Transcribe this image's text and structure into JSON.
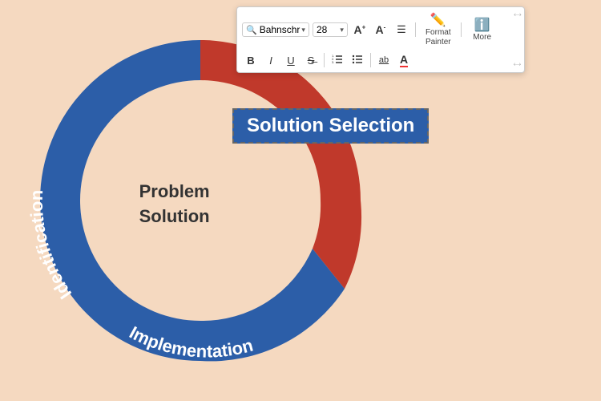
{
  "toolbar": {
    "font_name": "Bahnschr",
    "font_size": "28",
    "format_painter_label": "Format\nPainter",
    "more_label": "More",
    "buttons": {
      "bold": "B",
      "italic": "I",
      "underline": "U",
      "strikethrough": "S",
      "bullets": "≡",
      "list": "≡",
      "ab_underline": "ab",
      "font_color": "A",
      "increase_font": "A+",
      "decrease_font": "A-",
      "align": "≡"
    }
  },
  "diagram": {
    "center_line1": "Problem",
    "center_line2": "Solution",
    "selected_text": "Solution Selection",
    "segments": {
      "identification": "Identification",
      "implementation": "Implementation"
    }
  }
}
